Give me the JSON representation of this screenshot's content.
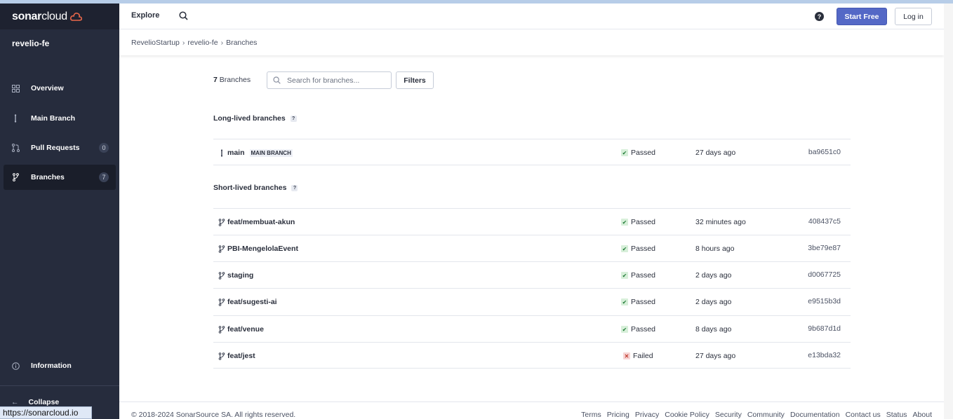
{
  "colors": {
    "sidebar_bg": "#262c3d",
    "accent": "#5468c6",
    "passed": "#1f7a36",
    "failed": "#c0392b"
  },
  "logo": {
    "bold": "sonar",
    "rest": "cloud"
  },
  "project": {
    "name": "revelio-fe"
  },
  "sidebar": {
    "items": [
      {
        "label": "Overview",
        "icon": "dashboard-icon"
      },
      {
        "label": "Main Branch",
        "icon": "branch-main-icon"
      },
      {
        "label": "Pull Requests",
        "icon": "pull-request-icon",
        "badge": "0"
      },
      {
        "label": "Branches",
        "icon": "branch-icon",
        "badge": "7",
        "active": true
      }
    ],
    "information": "Information",
    "collapse": "Collapse"
  },
  "status_url": "https://sonarcloud.io",
  "topbar": {
    "explore": "Explore",
    "help": "?",
    "start_free": "Start Free",
    "login": "Log in"
  },
  "breadcrumb": [
    "RevelioStartup",
    "revelio-fe",
    "Branches"
  ],
  "branches_header": {
    "count": "7",
    "count_label": "Branches",
    "search_placeholder": "Search for branches...",
    "filters": "Filters"
  },
  "long_lived": {
    "title": "Long-lived branches",
    "help": "?",
    "rows": [
      {
        "name": "main",
        "badge": "MAIN BRANCH",
        "status": "Passed",
        "age": "27 days ago",
        "hash": "ba9651c0"
      }
    ]
  },
  "short_lived": {
    "title": "Short-lived branches",
    "help": "?",
    "rows": [
      {
        "name": "feat/membuat-akun",
        "status": "Passed",
        "age": "32 minutes ago",
        "hash": "408437c5"
      },
      {
        "name": "PBI-MengelolaEvent",
        "status": "Passed",
        "age": "8 hours ago",
        "hash": "3be79e87"
      },
      {
        "name": "staging",
        "status": "Passed",
        "age": "2 days ago",
        "hash": "d0067725"
      },
      {
        "name": "feat/sugesti-ai",
        "status": "Passed",
        "age": "2 days ago",
        "hash": "e9515b3d"
      },
      {
        "name": "feat/venue",
        "status": "Passed",
        "age": "8 days ago",
        "hash": "9b687d1d"
      },
      {
        "name": "feat/jest",
        "status": "Failed",
        "age": "27 days ago",
        "hash": "e13bda32"
      }
    ]
  },
  "footer": {
    "copyright": "© 2018-2024 SonarSource SA. All rights reserved.",
    "links": [
      "Terms",
      "Pricing",
      "Privacy",
      "Cookie Policy",
      "Security",
      "Community",
      "Documentation",
      "Contact us",
      "Status",
      "About"
    ]
  }
}
